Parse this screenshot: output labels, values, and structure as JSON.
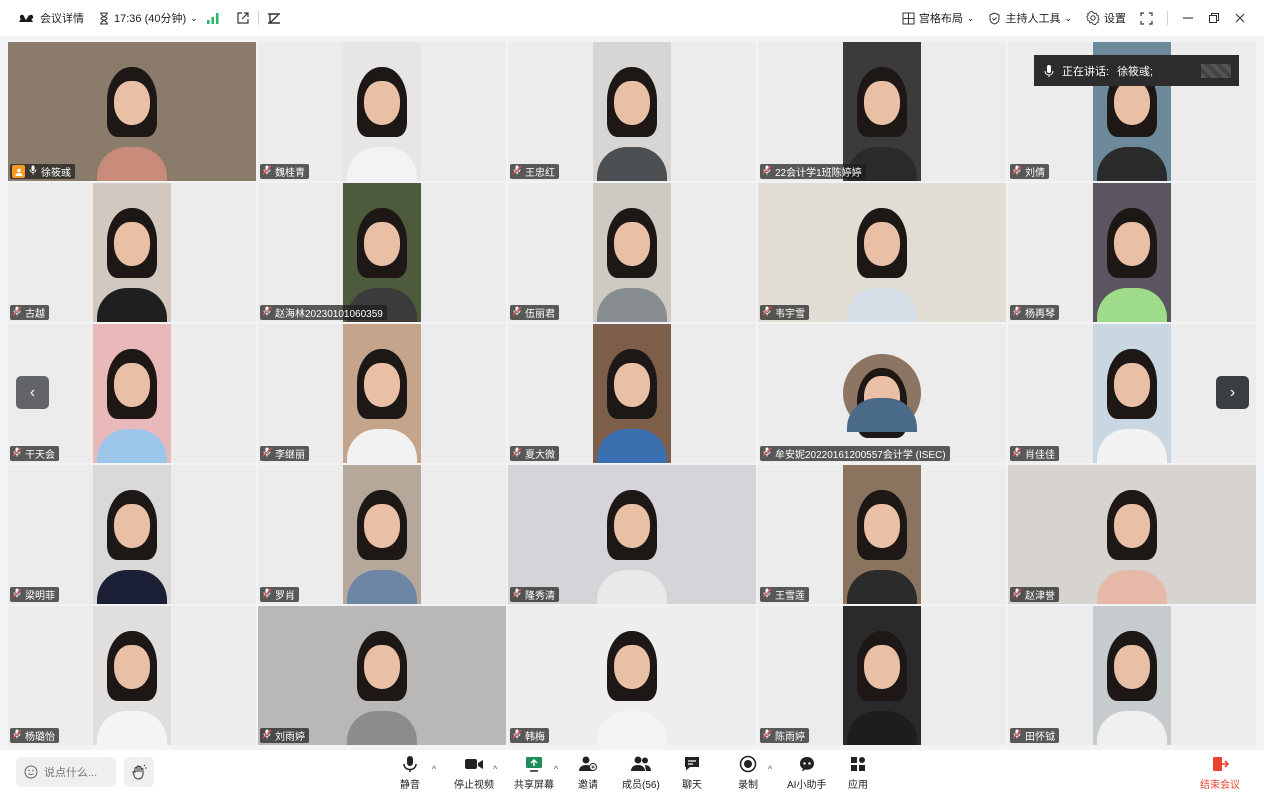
{
  "titlebar": {
    "meeting_details": "会议详情",
    "time": "17:36 (40分钟)",
    "layout": "宫格布局",
    "host_tools": "主持人工具",
    "settings": "设置"
  },
  "speaking": {
    "label": "正在讲话:",
    "name": "徐筱彧;"
  },
  "participants": [
    {
      "name": "徐筱彧",
      "host": true,
      "active": true,
      "bg": "#8a7b6a",
      "shirt": "#c98b7a",
      "wide": true
    },
    {
      "name": "魏桂青",
      "bg": "#e7e6e6",
      "shirt": "#f3f3f3"
    },
    {
      "name": "王忠红",
      "bg": "#d8d6d4",
      "shirt": "#4b4f52"
    },
    {
      "name": "22会计学1班陈婷婷",
      "bg": "#3b3b3b",
      "shirt": "#2a2a2a"
    },
    {
      "name": "刘倩",
      "bg": "#6c8a9a",
      "shirt": "#2b2b2b"
    },
    {
      "name": "古越",
      "bg": "#d3c8c0",
      "shirt": "#1f1f1f"
    },
    {
      "name": "赵海林20230101060359",
      "bg": "#4d5a3c",
      "shirt": "#3b3b3b"
    },
    {
      "name": "伍丽君",
      "bg": "#cfc9c4",
      "shirt": "#878c90"
    },
    {
      "name": "韦宇雪",
      "bg": "#e2ddd4",
      "shirt": "#d6dfe8",
      "wide": true
    },
    {
      "name": "杨再琴",
      "bg": "#5a5560",
      "shirt": "#9fdc8a"
    },
    {
      "name": "干天会",
      "bg": "#e8b9b8",
      "shirt": "#9cc6ea"
    },
    {
      "name": "李继丽",
      "bg": "#c4a58c",
      "shirt": "#f2f2f2"
    },
    {
      "name": "夏大微",
      "bg": "#7c5e4a",
      "shirt": "#3a6fb0"
    },
    {
      "name": "牟安妮20220161200557会计学 (ISEC)",
      "bg": "#8c7563",
      "shirt": "#4a6a8a",
      "circle": true
    },
    {
      "name": "肖佳佳",
      "bg": "#c9d7e3",
      "shirt": "#f2f2f2"
    },
    {
      "name": "梁明菲",
      "bg": "#d9d9d9",
      "shirt": "#1b2036"
    },
    {
      "name": "罗肖",
      "bg": "#b5a79a",
      "shirt": "#6d86a6"
    },
    {
      "name": "隆秀清",
      "bg": "#d6d4d8",
      "shirt": "#e9e9e9",
      "wide": true
    },
    {
      "name": "王雪莲",
      "bg": "#8a7460",
      "shirt": "#2b2b2b"
    },
    {
      "name": "赵津誉",
      "bg": "#d7d3ce",
      "shirt": "#e6b8a8",
      "wide": true
    },
    {
      "name": "杨璐怡",
      "bg": "#e1dfde",
      "shirt": "#f5f5f5"
    },
    {
      "name": "刘雨婷",
      "bg": "#b9b8b6",
      "shirt": "#8c8c8c",
      "wide": true
    },
    {
      "name": "韩梅",
      "bg": "#eeeeee",
      "shirt": "#f4f4f4"
    },
    {
      "name": "陈雨婷",
      "bg": "#2a2a2c",
      "shirt": "#1d1d1d"
    },
    {
      "name": "田怀钺",
      "bg": "#c6cbcd",
      "shirt": "#f0f0f0"
    }
  ],
  "toolbar": {
    "chat_placeholder": "说点什么...",
    "mute": "静音",
    "stop_video": "停止视频",
    "share_screen": "共享屏幕",
    "invite": "邀请",
    "members": "成员(56)",
    "chat": "聊天",
    "record": "录制",
    "ai_assistant": "AI小助手",
    "apps": "应用",
    "end_meeting": "结束会议"
  },
  "colors": {
    "active_border": "#3bc57f",
    "end_meeting": "#e8432f",
    "host_badge": "#f59a23",
    "signal": "#28b869"
  }
}
